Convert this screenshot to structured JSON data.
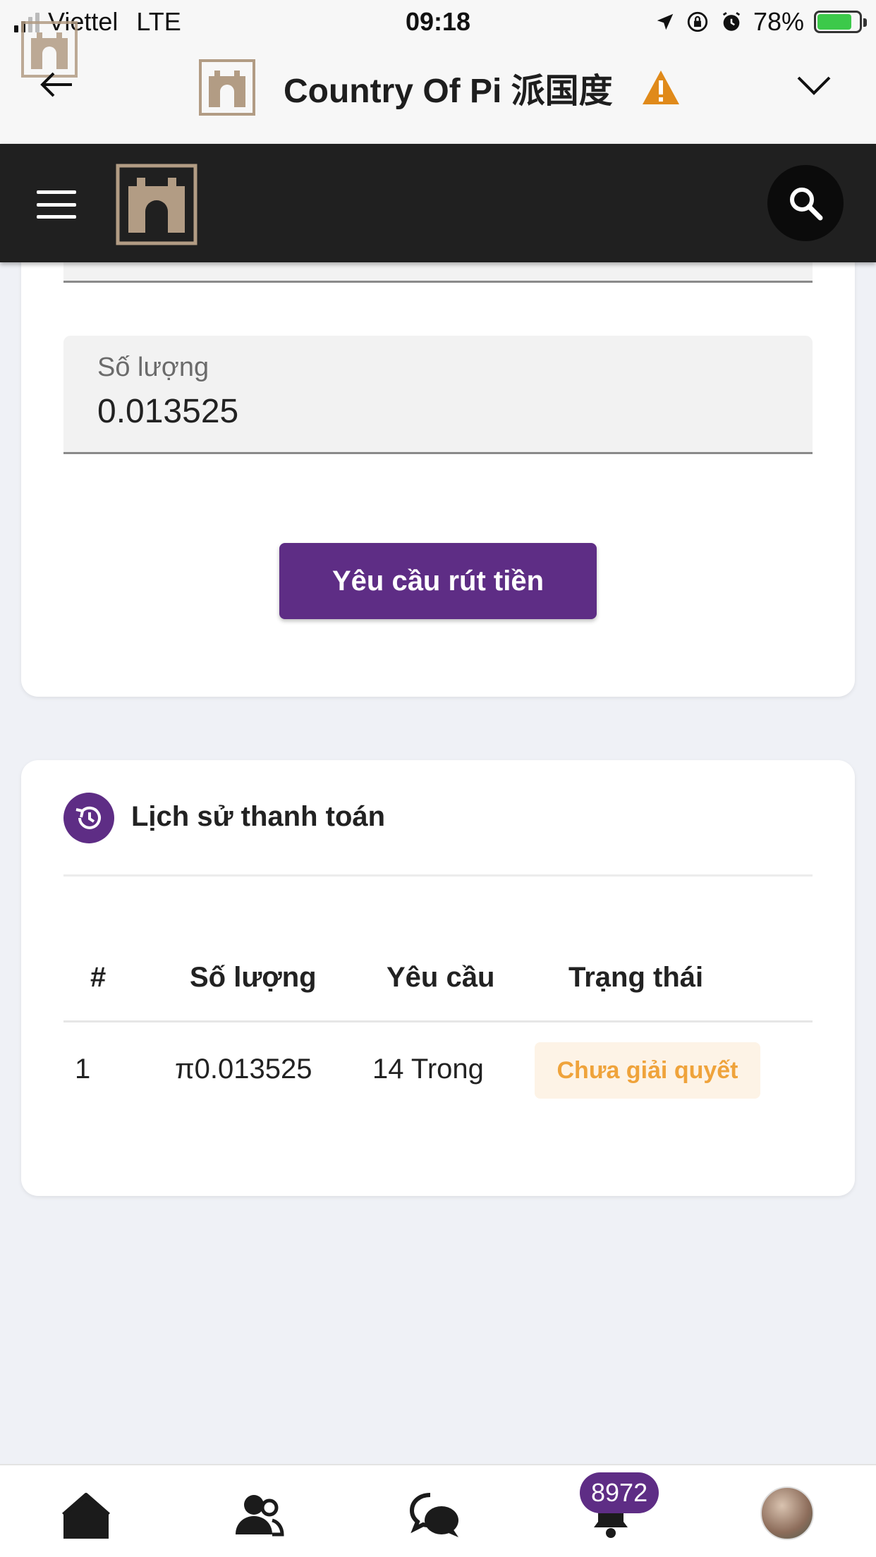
{
  "status_bar": {
    "carrier": "Viettel",
    "network": "LTE",
    "time": "09:18",
    "battery": "78%",
    "battery_level": 0.78
  },
  "app_header": {
    "title": "Country Of Pi 派国度"
  },
  "withdraw_form": {
    "amount_label": "Số lượng",
    "amount_value": "0.013525",
    "submit_label": "Yêu cầu rút tiền"
  },
  "payment_history": {
    "title": "Lịch sử thanh toán",
    "columns": [
      "#",
      "Số lượng",
      "Yêu cầu",
      "Trạng thái"
    ],
    "rows": [
      {
        "index": "1",
        "amount": "π0.013525",
        "request": "14 Trong",
        "status": "Chưa giải quyết"
      }
    ]
  },
  "tab_bar": {
    "notification_count": "8972",
    "tabs": [
      "home-icon",
      "friends-icon",
      "chat-icon",
      "bell-icon",
      "avatar"
    ]
  },
  "colors": {
    "accent": "#5e2d85",
    "navbar": "#202020",
    "pending_text": "#efa33b",
    "pending_bg": "#fdf3e6",
    "warning": "#e08a1a",
    "logo": "#b29c84"
  }
}
